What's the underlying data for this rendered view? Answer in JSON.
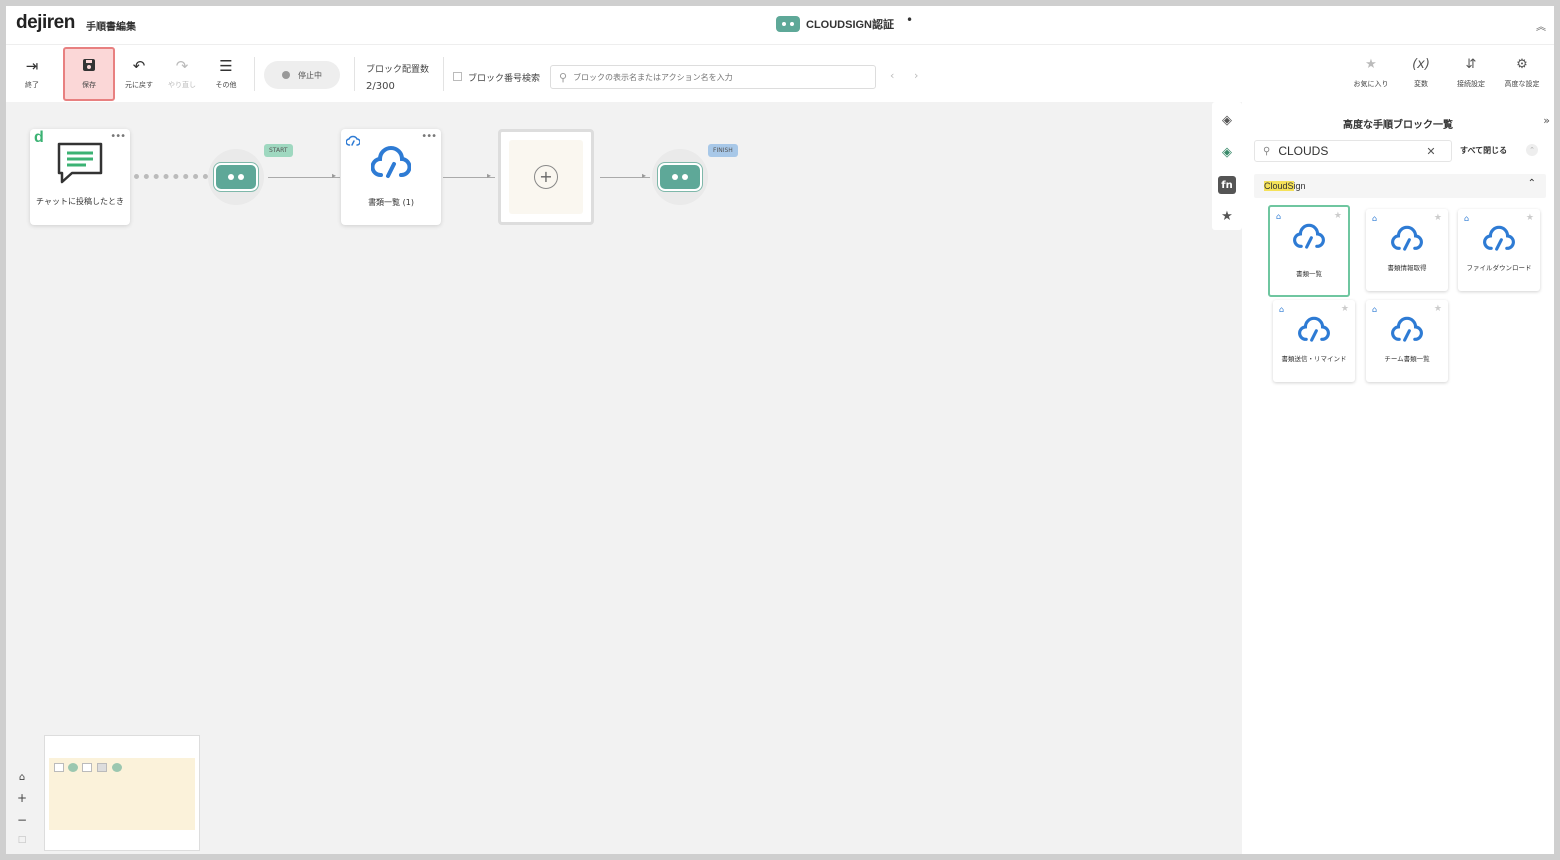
{
  "app": {
    "logo": "dejiren",
    "subtitle": "手順書編集",
    "doc_title": "CLOUDSIGN認証",
    "unsaved_marker": "•"
  },
  "toolbar": {
    "exit_label": "終了",
    "save_label": "保存",
    "undo_label": "元に戻す",
    "redo_label": "やり直し",
    "more_label": "その他",
    "status_label": "停止中",
    "block_count_label": "ブロック配置数",
    "block_count_value": "2/300",
    "block_number_search_label": "ブロック番号検索",
    "search_placeholder": "ブロックの表示名またはアクション名を入力",
    "favorites_label": "お気に入り",
    "variables_label": "変数",
    "connection_label": "接続設定",
    "advanced_label": "高度な設定"
  },
  "canvas": {
    "trigger_block_label": "チャットに投稿したとき",
    "start_bubble": "START",
    "finish_bubble": "FINISH",
    "action_block_label": "書類一覧 (1)"
  },
  "panel": {
    "title": "高度な手順ブロック一覧",
    "search_value": "CLOUDS",
    "close_all_label": "すべて閉じる",
    "category": {
      "name_highlight": "CloudS",
      "name_rest": "ign"
    },
    "items": [
      {
        "label": "書類一覧"
      },
      {
        "label": "書類情報取得"
      },
      {
        "label": "ファイルダウンロード"
      },
      {
        "label": "書類送信・リマインド"
      },
      {
        "label": "チーム書類一覧"
      }
    ]
  },
  "colors": {
    "robot": "#5ea898",
    "cloudsign_blue": "#2e7bd4",
    "save_highlight": "#fbd7d7",
    "selected_card_border": "#6fc6a0"
  }
}
